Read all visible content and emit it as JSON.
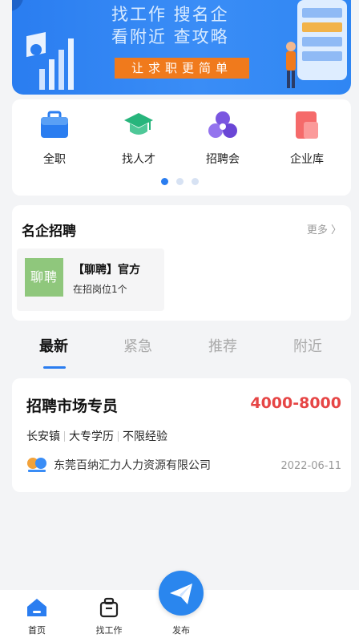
{
  "banner": {
    "line1": "找工作  搜名企",
    "line2": "看附近  查攻略",
    "slogan": "让求职更简单"
  },
  "categories": [
    {
      "label": "全职",
      "icon": "briefcase-icon"
    },
    {
      "label": "找人才",
      "icon": "graduation-cap-icon"
    },
    {
      "label": "招聘会",
      "icon": "people-group-icon"
    },
    {
      "label": "企业库",
      "icon": "company-icon"
    }
  ],
  "famous": {
    "title": "名企招聘",
    "more": "更多 〉",
    "company": {
      "logo_text": "聊聘",
      "name": "【聊聘】官方",
      "positions": "在招岗位1个"
    }
  },
  "tabs": [
    "最新",
    "紧急",
    "推荐",
    "附近"
  ],
  "job": {
    "title": "招聘市场专员",
    "salary": "4000-8000",
    "tags": [
      "长安镇",
      "大专学历",
      "不限经验"
    ],
    "company": "东莞百纳汇力人力资源有限公司",
    "date": "2022-06-11"
  },
  "nav": {
    "home": "首页",
    "jobs": "找工作",
    "publish": "发布"
  },
  "colors": {
    "accent": "#2a7df0",
    "salary": "#e64545",
    "slogan_bg": "#f07a1c"
  }
}
